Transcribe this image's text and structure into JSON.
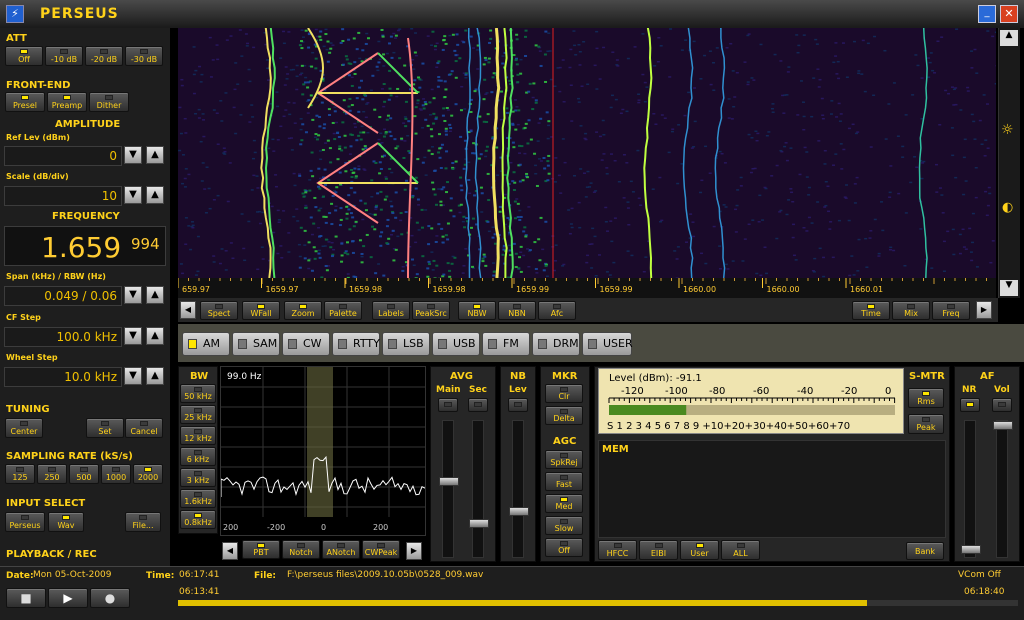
{
  "app": {
    "title": "PERSEUS"
  },
  "att": {
    "label": "ATT",
    "buttons": [
      "Off",
      "-10 dB",
      "-20 dB",
      "-30 dB"
    ],
    "active": 0
  },
  "frontend": {
    "label": "FRONT-END",
    "buttons": [
      "Presel",
      "Preamp",
      "Dither"
    ],
    "active": [
      true,
      true,
      false
    ]
  },
  "amplitude": {
    "label": "AMPLITUDE",
    "ref_label": "Ref Lev (dBm)",
    "ref_value": "0",
    "scale_label": "Scale (dB/div)",
    "scale_value": "10"
  },
  "frequency": {
    "label": "FREQUENCY",
    "main": "1.659",
    "fine": "994",
    "span_label": "Span (kHz) / RBW (Hz)",
    "span_value": "0.049 / 0.06",
    "cf_label": "CF Step",
    "cf_value": "100.0 kHz",
    "wheel_label": "Wheel Step",
    "wheel_value": "10.0 kHz"
  },
  "tuning": {
    "label": "TUNING",
    "buttons": [
      "Center",
      "Set",
      "Cancel"
    ]
  },
  "sampling": {
    "label": "SAMPLING RATE (kS/s)",
    "buttons": [
      "125",
      "250",
      "500",
      "1000",
      "2000"
    ],
    "active": 4
  },
  "input": {
    "label": "INPUT SELECT",
    "buttons": [
      "Perseus",
      "Wav",
      "File..."
    ],
    "active": 1
  },
  "playback": {
    "label": "PLAYBACK / REC"
  },
  "spectrum": {
    "ticks": [
      "659.97",
      "1659.97",
      "1659.98",
      "1659.98",
      "1659.99",
      "1659.99",
      "1660.00",
      "1660.00",
      "1660.01"
    ]
  },
  "toolbar": {
    "left": [
      "Spect",
      "WFall",
      "Zoom",
      "Palette",
      "Labels",
      "PeakSrc",
      "NBW",
      "NBN",
      "Afc"
    ],
    "active": [
      false,
      true,
      true,
      false,
      false,
      false,
      true,
      false,
      false
    ],
    "right": [
      "Time",
      "Mix",
      "Freq"
    ],
    "right_active": [
      true,
      false,
      false
    ]
  },
  "modes": {
    "items": [
      "AM",
      "SAM",
      "CW",
      "RTTY",
      "LSB",
      "USB",
      "FM",
      "DRM",
      "USER"
    ],
    "active": 0
  },
  "bw": {
    "label": "BW",
    "buttons": [
      "50 kHz",
      "25 kHz",
      "12 kHz",
      "6 kHz",
      "3 kHz",
      "1.6kHz",
      "0.8kHz"
    ],
    "active": 6,
    "readout": "99.0 Hz",
    "axis": [
      "200",
      "-200",
      "0",
      "200"
    ]
  },
  "filter": {
    "buttons": [
      "PBT",
      "Notch",
      "ANotch",
      "CWPeak"
    ],
    "active": [
      true,
      false,
      false,
      false
    ]
  },
  "avg": {
    "label": "AVG",
    "main": "Main",
    "sec": "Sec"
  },
  "nb": {
    "label": "NB",
    "lev": "Lev"
  },
  "mkr": {
    "label": "MKR",
    "buttons": [
      "Clr",
      "Delta"
    ]
  },
  "agc": {
    "label": "AGC",
    "buttons": [
      "SpkRej",
      "Fast",
      "Med",
      "Slow",
      "Off"
    ],
    "active": 2
  },
  "level": {
    "title": "Level (dBm): -91.1",
    "scale_top": [
      "-120",
      "-100",
      "-80",
      "-60",
      "-40",
      "-20",
      "0"
    ],
    "scale_bottom": "S 1 2 3 4 5 6 7 8 9 +10+20+30+40+50+60+70",
    "bar_fraction": 0.27
  },
  "smtr": {
    "label": "S-MTR",
    "buttons": [
      "Rms",
      "Peak"
    ],
    "active": 0
  },
  "af": {
    "label": "AF",
    "nr": "NR",
    "vol": "Vol"
  },
  "mem": {
    "label": "MEM",
    "buttons": [
      "HFCC",
      "EIBI",
      "User",
      "ALL"
    ],
    "active": 2,
    "bank": "Bank"
  },
  "status": {
    "date_label": "Date:",
    "date": "Mon 05-Oct-2009",
    "time_label": "Time:",
    "time": "06:17:41",
    "file_label": "File:",
    "file": "F:\\perseus files\\2009.10.05b\\0528_009.wav",
    "vcom": "VCom Off",
    "start": "06:13:41",
    "end": "06:18:40",
    "progress": 0.82
  },
  "colors": {
    "accent": "#ffd21a",
    "panel": "#262626",
    "led": "#ffe600"
  }
}
